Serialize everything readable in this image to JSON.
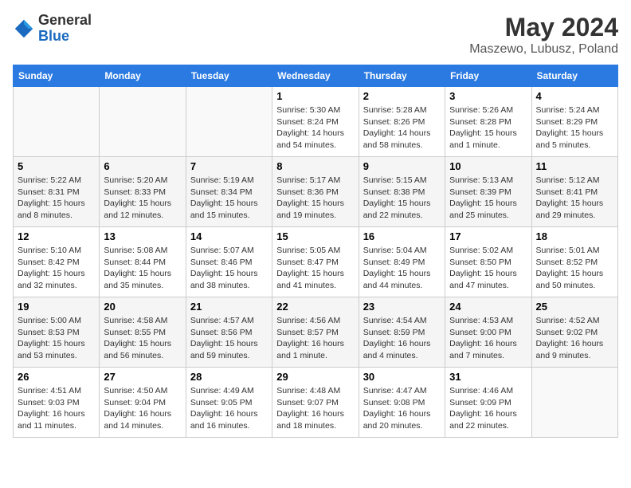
{
  "header": {
    "logo_general": "General",
    "logo_blue": "Blue",
    "month_year": "May 2024",
    "location": "Maszewo, Lubusz, Poland"
  },
  "weekdays": [
    "Sunday",
    "Monday",
    "Tuesday",
    "Wednesday",
    "Thursday",
    "Friday",
    "Saturday"
  ],
  "weeks": [
    [
      {
        "day": "",
        "info": ""
      },
      {
        "day": "",
        "info": ""
      },
      {
        "day": "",
        "info": ""
      },
      {
        "day": "1",
        "info": "Sunrise: 5:30 AM\nSunset: 8:24 PM\nDaylight: 14 hours\nand 54 minutes."
      },
      {
        "day": "2",
        "info": "Sunrise: 5:28 AM\nSunset: 8:26 PM\nDaylight: 14 hours\nand 58 minutes."
      },
      {
        "day": "3",
        "info": "Sunrise: 5:26 AM\nSunset: 8:28 PM\nDaylight: 15 hours\nand 1 minute."
      },
      {
        "day": "4",
        "info": "Sunrise: 5:24 AM\nSunset: 8:29 PM\nDaylight: 15 hours\nand 5 minutes."
      }
    ],
    [
      {
        "day": "5",
        "info": "Sunrise: 5:22 AM\nSunset: 8:31 PM\nDaylight: 15 hours\nand 8 minutes."
      },
      {
        "day": "6",
        "info": "Sunrise: 5:20 AM\nSunset: 8:33 PM\nDaylight: 15 hours\nand 12 minutes."
      },
      {
        "day": "7",
        "info": "Sunrise: 5:19 AM\nSunset: 8:34 PM\nDaylight: 15 hours\nand 15 minutes."
      },
      {
        "day": "8",
        "info": "Sunrise: 5:17 AM\nSunset: 8:36 PM\nDaylight: 15 hours\nand 19 minutes."
      },
      {
        "day": "9",
        "info": "Sunrise: 5:15 AM\nSunset: 8:38 PM\nDaylight: 15 hours\nand 22 minutes."
      },
      {
        "day": "10",
        "info": "Sunrise: 5:13 AM\nSunset: 8:39 PM\nDaylight: 15 hours\nand 25 minutes."
      },
      {
        "day": "11",
        "info": "Sunrise: 5:12 AM\nSunset: 8:41 PM\nDaylight: 15 hours\nand 29 minutes."
      }
    ],
    [
      {
        "day": "12",
        "info": "Sunrise: 5:10 AM\nSunset: 8:42 PM\nDaylight: 15 hours\nand 32 minutes."
      },
      {
        "day": "13",
        "info": "Sunrise: 5:08 AM\nSunset: 8:44 PM\nDaylight: 15 hours\nand 35 minutes."
      },
      {
        "day": "14",
        "info": "Sunrise: 5:07 AM\nSunset: 8:46 PM\nDaylight: 15 hours\nand 38 minutes."
      },
      {
        "day": "15",
        "info": "Sunrise: 5:05 AM\nSunset: 8:47 PM\nDaylight: 15 hours\nand 41 minutes."
      },
      {
        "day": "16",
        "info": "Sunrise: 5:04 AM\nSunset: 8:49 PM\nDaylight: 15 hours\nand 44 minutes."
      },
      {
        "day": "17",
        "info": "Sunrise: 5:02 AM\nSunset: 8:50 PM\nDaylight: 15 hours\nand 47 minutes."
      },
      {
        "day": "18",
        "info": "Sunrise: 5:01 AM\nSunset: 8:52 PM\nDaylight: 15 hours\nand 50 minutes."
      }
    ],
    [
      {
        "day": "19",
        "info": "Sunrise: 5:00 AM\nSunset: 8:53 PM\nDaylight: 15 hours\nand 53 minutes."
      },
      {
        "day": "20",
        "info": "Sunrise: 4:58 AM\nSunset: 8:55 PM\nDaylight: 15 hours\nand 56 minutes."
      },
      {
        "day": "21",
        "info": "Sunrise: 4:57 AM\nSunset: 8:56 PM\nDaylight: 15 hours\nand 59 minutes."
      },
      {
        "day": "22",
        "info": "Sunrise: 4:56 AM\nSunset: 8:57 PM\nDaylight: 16 hours\nand 1 minute."
      },
      {
        "day": "23",
        "info": "Sunrise: 4:54 AM\nSunset: 8:59 PM\nDaylight: 16 hours\nand 4 minutes."
      },
      {
        "day": "24",
        "info": "Sunrise: 4:53 AM\nSunset: 9:00 PM\nDaylight: 16 hours\nand 7 minutes."
      },
      {
        "day": "25",
        "info": "Sunrise: 4:52 AM\nSunset: 9:02 PM\nDaylight: 16 hours\nand 9 minutes."
      }
    ],
    [
      {
        "day": "26",
        "info": "Sunrise: 4:51 AM\nSunset: 9:03 PM\nDaylight: 16 hours\nand 11 minutes."
      },
      {
        "day": "27",
        "info": "Sunrise: 4:50 AM\nSunset: 9:04 PM\nDaylight: 16 hours\nand 14 minutes."
      },
      {
        "day": "28",
        "info": "Sunrise: 4:49 AM\nSunset: 9:05 PM\nDaylight: 16 hours\nand 16 minutes."
      },
      {
        "day": "29",
        "info": "Sunrise: 4:48 AM\nSunset: 9:07 PM\nDaylight: 16 hours\nand 18 minutes."
      },
      {
        "day": "30",
        "info": "Sunrise: 4:47 AM\nSunset: 9:08 PM\nDaylight: 16 hours\nand 20 minutes."
      },
      {
        "day": "31",
        "info": "Sunrise: 4:46 AM\nSunset: 9:09 PM\nDaylight: 16 hours\nand 22 minutes."
      },
      {
        "day": "",
        "info": ""
      }
    ]
  ]
}
